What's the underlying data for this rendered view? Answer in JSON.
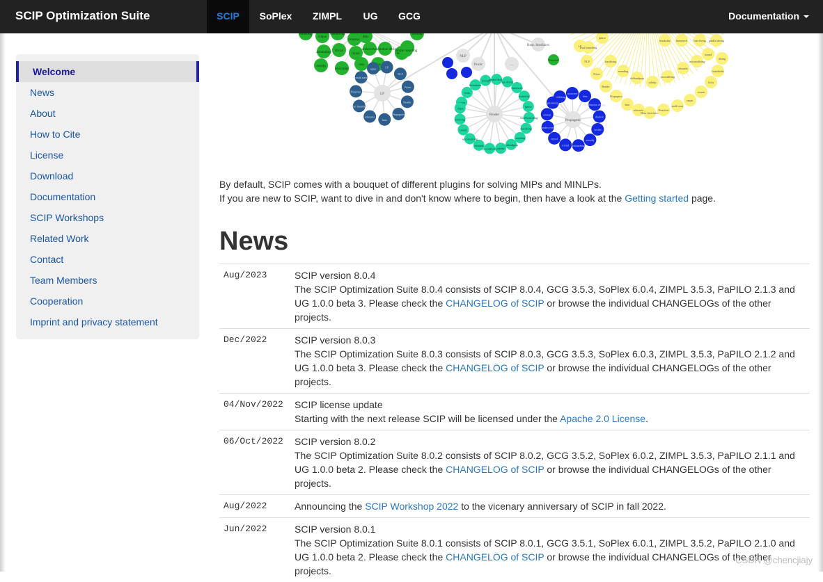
{
  "navbar": {
    "brand": "SCIP Optimization Suite",
    "tabs": [
      "SCIP",
      "SoPlex",
      "ZIMPL",
      "UG",
      "GCG"
    ],
    "documentation": "Documentation"
  },
  "sidebar": {
    "items": [
      "Welcome",
      "News",
      "About",
      "How to Cite",
      "License",
      "Download",
      "Documentation",
      "SCIP Workshops",
      "Related Work",
      "Contact",
      "Team Members",
      "Cooperation",
      "Imprint and privacy statement"
    ]
  },
  "graph": {
    "labels": [
      "LP",
      "NLP",
      "Pricer",
      "Reader",
      "Propagator",
      "heur",
      "relaxator",
      "Heur. Interfaces",
      "Presolver",
      "multi start",
      "repair",
      "octane",
      "locks",
      "fixandinfer",
      "diving",
      "guided diving",
      "line diving",
      "linesearch",
      "feasibility",
      "lpface",
      "local branching",
      "fracdiving",
      "rounding",
      "shiftandprop",
      "subnlp",
      "pscostdiving",
      "vbounds",
      "actconsdiving",
      "bound",
      "intdiving",
      "clique",
      "coefdiving",
      "crossover",
      "dins",
      "distribution diving",
      "dualval",
      "veclen",
      "zeroobj",
      "zirounding",
      "trivial",
      "trysol",
      "undercover",
      "oneopt",
      "proximity",
      "rens",
      "rins",
      "simple rounding"
    ]
  },
  "intro": {
    "line1": "By default, SCIP comes with a bouquet of different plugins for solving MIPs and MINLPs.",
    "line2_before": "If you are new to SCIP, want to dive in and don't know where to begin, then have a look at the ",
    "line2_link": "Getting started",
    "line2_after": " page."
  },
  "news": {
    "heading": "News",
    "rows": [
      {
        "date": "Aug/2023",
        "title": "SCIP version 8.0.4",
        "body1": "The SCIP Optimization Suite 8.0.4 consists of SCIP 8.0.4, GCG 3.5.3, SoPlex 6.0.4, ZIMPL 3.5.3, PaPILO 2.1.3 and UG 1.0.0 beta 3. Please check the ",
        "link": "CHANGELOG of SCIP",
        "body2": " or browse the individual CHANGELOGs of the other projects."
      },
      {
        "date": "Dec/2022",
        "title": "SCIP version 8.0.3",
        "body1": "The SCIP Optimization Suite 8.0.3 consists of SCIP 8.0.3, GCG 3.5.3, SoPlex 6.0.3, ZIMPL 3.5.3, PaPILO 2.1.2 and UG 1.0.0 beta 3. Please check the ",
        "link": "CHANGELOG of SCIP",
        "body2": " or browse the individual CHANGELOGs of the other projects."
      },
      {
        "date": "04/Nov/2022",
        "title": "SCIP license update",
        "body1": "Starting with the next release SCIP will be licensed under the ",
        "link": "Apache 2.0 License",
        "body2": "."
      },
      {
        "date": "06/Oct/2022",
        "title": "SCIP version 8.0.2",
        "body1": "The SCIP Optimization Suite 8.0.2 consists of SCIP 8.0.2, GCG 3.5.2, SoPlex 6.0.2, ZIMPL 3.5.3, PaPILO 2.1.1 and UG 1.0.0 beta 2. Please check the ",
        "link": "CHANGELOG of SCIP",
        "body2": " or browse the individual CHANGELOGs of the other projects."
      },
      {
        "date": "Aug/2022",
        "title": "",
        "body1": "Announcing the ",
        "link": "SCIP Workshop 2022",
        "body2": " to the vicenary anniversary of SCIP in fall 2022."
      },
      {
        "date": "Jun/2022",
        "title": "SCIP version 8.0.1",
        "body1": "The SCIP Optimization Suite 8.0.1 consists of SCIP 8.0.1, GCG 3.5.1, SoPlex 6.0.1, ZIMPL 3.5.2, PaPILO 2.1.0 and UG 1.0.0 beta 2. Please check the ",
        "link": "CHANGELOG of SCIP",
        "body2": " or browse the individual CHANGELOGs of the other projects."
      }
    ]
  },
  "watermark": "CSDN @chencjiajy",
  "colors": {
    "navbar_bg": "#222222",
    "active_tab": "#1e7be0",
    "link": "#2a78c2",
    "sidebar_bg": "#f0f0f0",
    "green_nodes": "#22b22e",
    "teal_nodes": "#1ed6a0",
    "blue_nodes": "#1428e0",
    "steel_nodes": "#2e5e8c",
    "yellow_nodes": "#fbf07a"
  }
}
